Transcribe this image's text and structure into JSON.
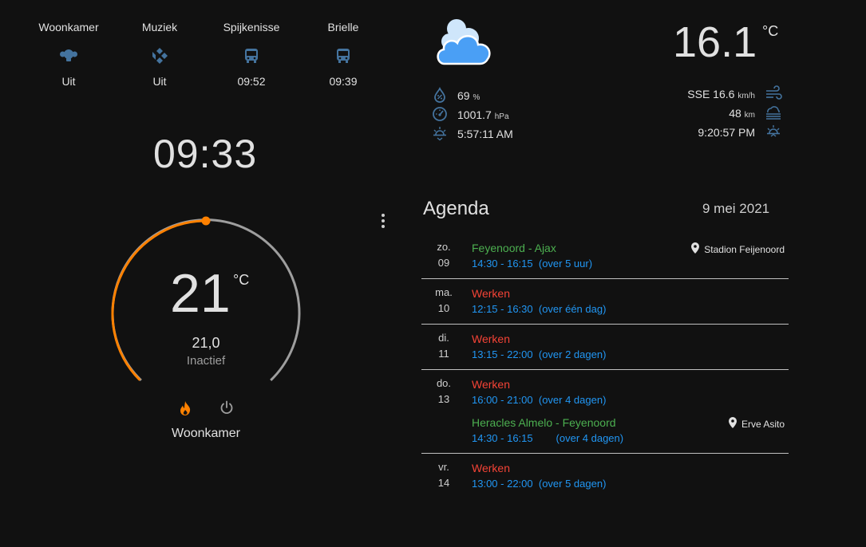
{
  "entities": [
    {
      "name": "Woonkamer",
      "icon": "light-bulb-group-icon",
      "state": "Uit"
    },
    {
      "name": "Muziek",
      "icon": "kodi-icon",
      "state": "Uit"
    },
    {
      "name": "Spijkenisse",
      "icon": "bus-icon",
      "state": "09:52"
    },
    {
      "name": "Brielle",
      "icon": "bus-icon",
      "state": "09:39"
    }
  ],
  "clock": "09:33",
  "thermostat": {
    "target": "21",
    "unit": "°C",
    "current": "21,0",
    "status": "Inactief",
    "name": "Woonkamer",
    "level": 0.5,
    "colors": {
      "heat": "#ff8100",
      "off_track": "#9e9e9e"
    }
  },
  "weather": {
    "condition_icon": "cloudy-icon",
    "temperature": "16.1",
    "unit": "°C",
    "humidity": "69",
    "humidity_unit": "%",
    "pressure": "1001.7",
    "pressure_unit": "hPa",
    "sunrise": "5:57:11 AM",
    "wind": "SSE 16.6",
    "wind_unit": "km/h",
    "visibility": "48",
    "visibility_unit": "km",
    "sunset": "9:20:57 PM"
  },
  "agenda": {
    "title": "Agenda",
    "date": "9 mei 2021",
    "days": [
      {
        "dow": "zo.",
        "day": "09",
        "events": [
          {
            "title": "Feyenoord - Ajax",
            "color": "#4caf50",
            "time": "14:30 - 16:15",
            "relative": "(over 5 uur)",
            "location": "Stadion Feijenoord"
          }
        ]
      },
      {
        "dow": "ma.",
        "day": "10",
        "events": [
          {
            "title": "Werken",
            "color": "#f44336",
            "time": "12:15 - 16:30",
            "relative": "(over één dag)",
            "location": ""
          }
        ]
      },
      {
        "dow": "di.",
        "day": "11",
        "events": [
          {
            "title": "Werken",
            "color": "#f44336",
            "time": "13:15 - 22:00",
            "relative": "(over 2 dagen)",
            "location": ""
          }
        ]
      },
      {
        "dow": "do.",
        "day": "13",
        "events": [
          {
            "title": "Werken",
            "color": "#f44336",
            "time": "16:00 - 21:00",
            "relative": "(over 4 dagen)",
            "location": ""
          },
          {
            "title": "Heracles Almelo - Feyenoord",
            "color": "#4caf50",
            "time": "14:30 - 16:15",
            "relative": "(over 4 dagen)",
            "location": "Erve Asito"
          }
        ]
      },
      {
        "dow": "vr.",
        "day": "14",
        "events": [
          {
            "title": "Werken",
            "color": "#f44336",
            "time": "13:00 - 22:00",
            "relative": "(over 5 dagen)",
            "location": ""
          }
        ]
      }
    ]
  },
  "colors": {
    "background": "#111111",
    "icon_blue": "#44739e",
    "accent_orange": "#ff8100",
    "time_blue": "#2196f3"
  }
}
